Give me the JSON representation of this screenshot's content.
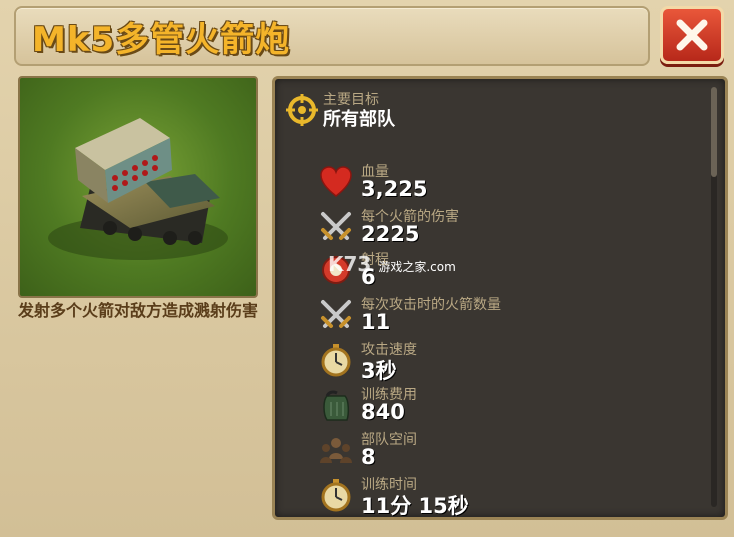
{
  "header": {
    "title": "Mk5多管火箭炮"
  },
  "description": "发射多个火箭对敌方造成溅射伤害",
  "target": {
    "label": "主要目标",
    "value": "所有部队"
  },
  "stats": [
    {
      "label": "血量",
      "value": "3,225",
      "icon": "heart-icon"
    },
    {
      "label": "每个火箭的伤害",
      "value": "2225",
      "icon": "crossed-swords-icon"
    },
    {
      "label": "射程",
      "value": "6",
      "icon": "range-icon"
    },
    {
      "label": "每次攻击时的火箭数量",
      "value": "11",
      "icon": "crossed-swords-icon"
    },
    {
      "label": "攻击速度",
      "value": "3秒",
      "icon": "stopwatch-icon"
    },
    {
      "label": "训练费用",
      "value": "840",
      "icon": "fuel-can-icon"
    },
    {
      "label": "部队空间",
      "value": "8",
      "icon": "troop-space-icon"
    },
    {
      "label": "训练时间",
      "value": "11分 15秒",
      "icon": "stopwatch-icon"
    }
  ],
  "watermark": {
    "brand": "K73",
    "text": "游戏之家",
    "domain": ".com"
  },
  "colors": {
    "title": "#f4b42a",
    "panel": "#3a3631",
    "close": "#d8432b"
  }
}
